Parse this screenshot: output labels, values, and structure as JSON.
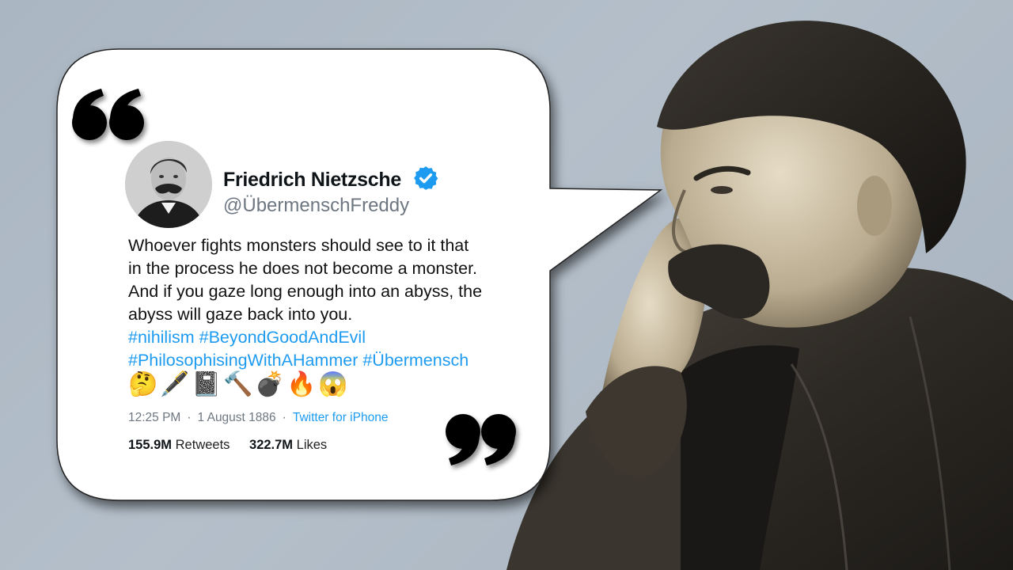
{
  "tweet": {
    "display_name": "Friedrich Nietzsche",
    "handle": "@ÜbermenschFreddy",
    "text_lines": [
      "Whoever fights monsters should see to it that",
      "in the process he does not become a monster.",
      "And if you gaze long enough into an abyss, the",
      "abyss will gaze back into you."
    ],
    "hashtags_line1": "#nihilism #BeyondGoodAndEvil",
    "hashtags_line2": "#PhilosophisingWithAHammer #Übermensch",
    "emojis": [
      "🤔",
      "🖋️",
      "📓",
      "🔨",
      "💣",
      "🔥",
      "😱"
    ],
    "time": "12:25 PM",
    "date": "1 August 1886",
    "source": "Twitter for iPhone",
    "retweets_count": "155.9M",
    "retweets_label": "Retweets",
    "likes_count": "322.7M",
    "likes_label": "Likes"
  },
  "icons": {
    "verified": "verified-badge-icon",
    "open_quote": "open-quote-icon",
    "close_quote": "close-quote-icon"
  },
  "colors": {
    "background": "#aab6c2",
    "bubble": "#ffffff",
    "link": "#1d9bf0",
    "muted": "#6e7781",
    "verified": "#1d9bf0"
  }
}
